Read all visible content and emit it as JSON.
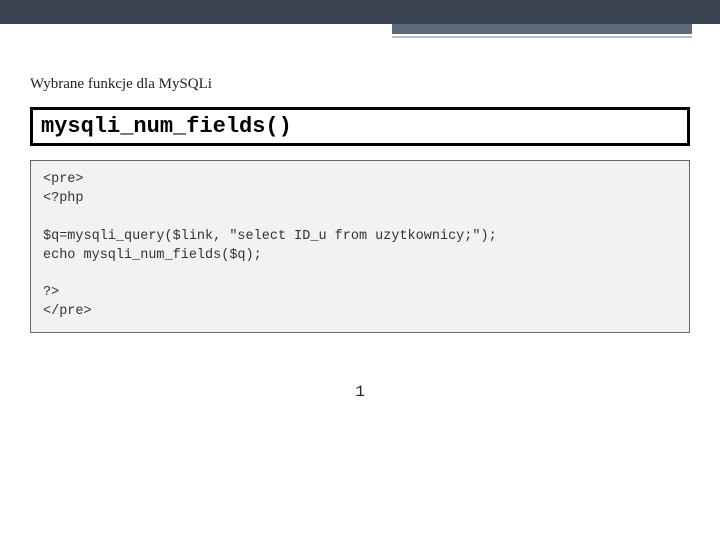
{
  "subtitle": "Wybrane funkcje dla MySQLi",
  "function_name": "mysqli_num_fields()",
  "code": "<pre>\n<?php\n\n$q=mysqli_query($link, \"select ID_u from uzytkownicy;\");\necho mysqli_num_fields($q);\n\n?>\n</pre>",
  "output": "1"
}
